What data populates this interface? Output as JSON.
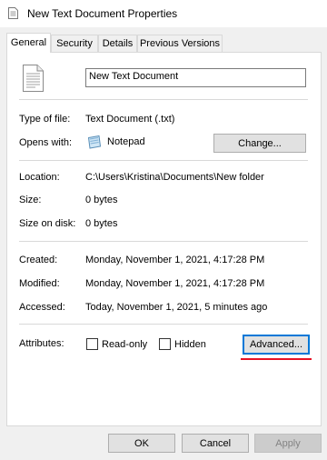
{
  "window": {
    "title": "New Text Document Properties"
  },
  "tabs": [
    {
      "label": "General",
      "active": true
    },
    {
      "label": "Security"
    },
    {
      "label": "Details"
    },
    {
      "label": "Previous Versions"
    }
  ],
  "general": {
    "file_name": "New Text Document",
    "type_of_file_label": "Type of file:",
    "type_of_file_value": "Text Document (.txt)",
    "opens_with_label": "Opens with:",
    "opens_with_value": "Notepad",
    "change_button": "Change...",
    "location_label": "Location:",
    "location_value": "C:\\Users\\Kristina\\Documents\\New folder",
    "size_label": "Size:",
    "size_value": "0 bytes",
    "size_on_disk_label": "Size on disk:",
    "size_on_disk_value": "0 bytes",
    "created_label": "Created:",
    "created_value": "Monday, November 1, 2021, 4:17:28 PM",
    "modified_label": "Modified:",
    "modified_value": "Monday, November 1, 2021, 4:17:28 PM",
    "accessed_label": "Accessed:",
    "accessed_value": "Today, November 1, 2021, 5 minutes ago",
    "attributes_label": "Attributes:",
    "readonly_label": "Read-only",
    "hidden_label": "Hidden",
    "advanced_button": "Advanced..."
  },
  "footer": {
    "ok": "OK",
    "cancel": "Cancel",
    "apply": "Apply"
  },
  "colors": {
    "accent": "#0078d7",
    "highlight_underline": "#e81123"
  }
}
